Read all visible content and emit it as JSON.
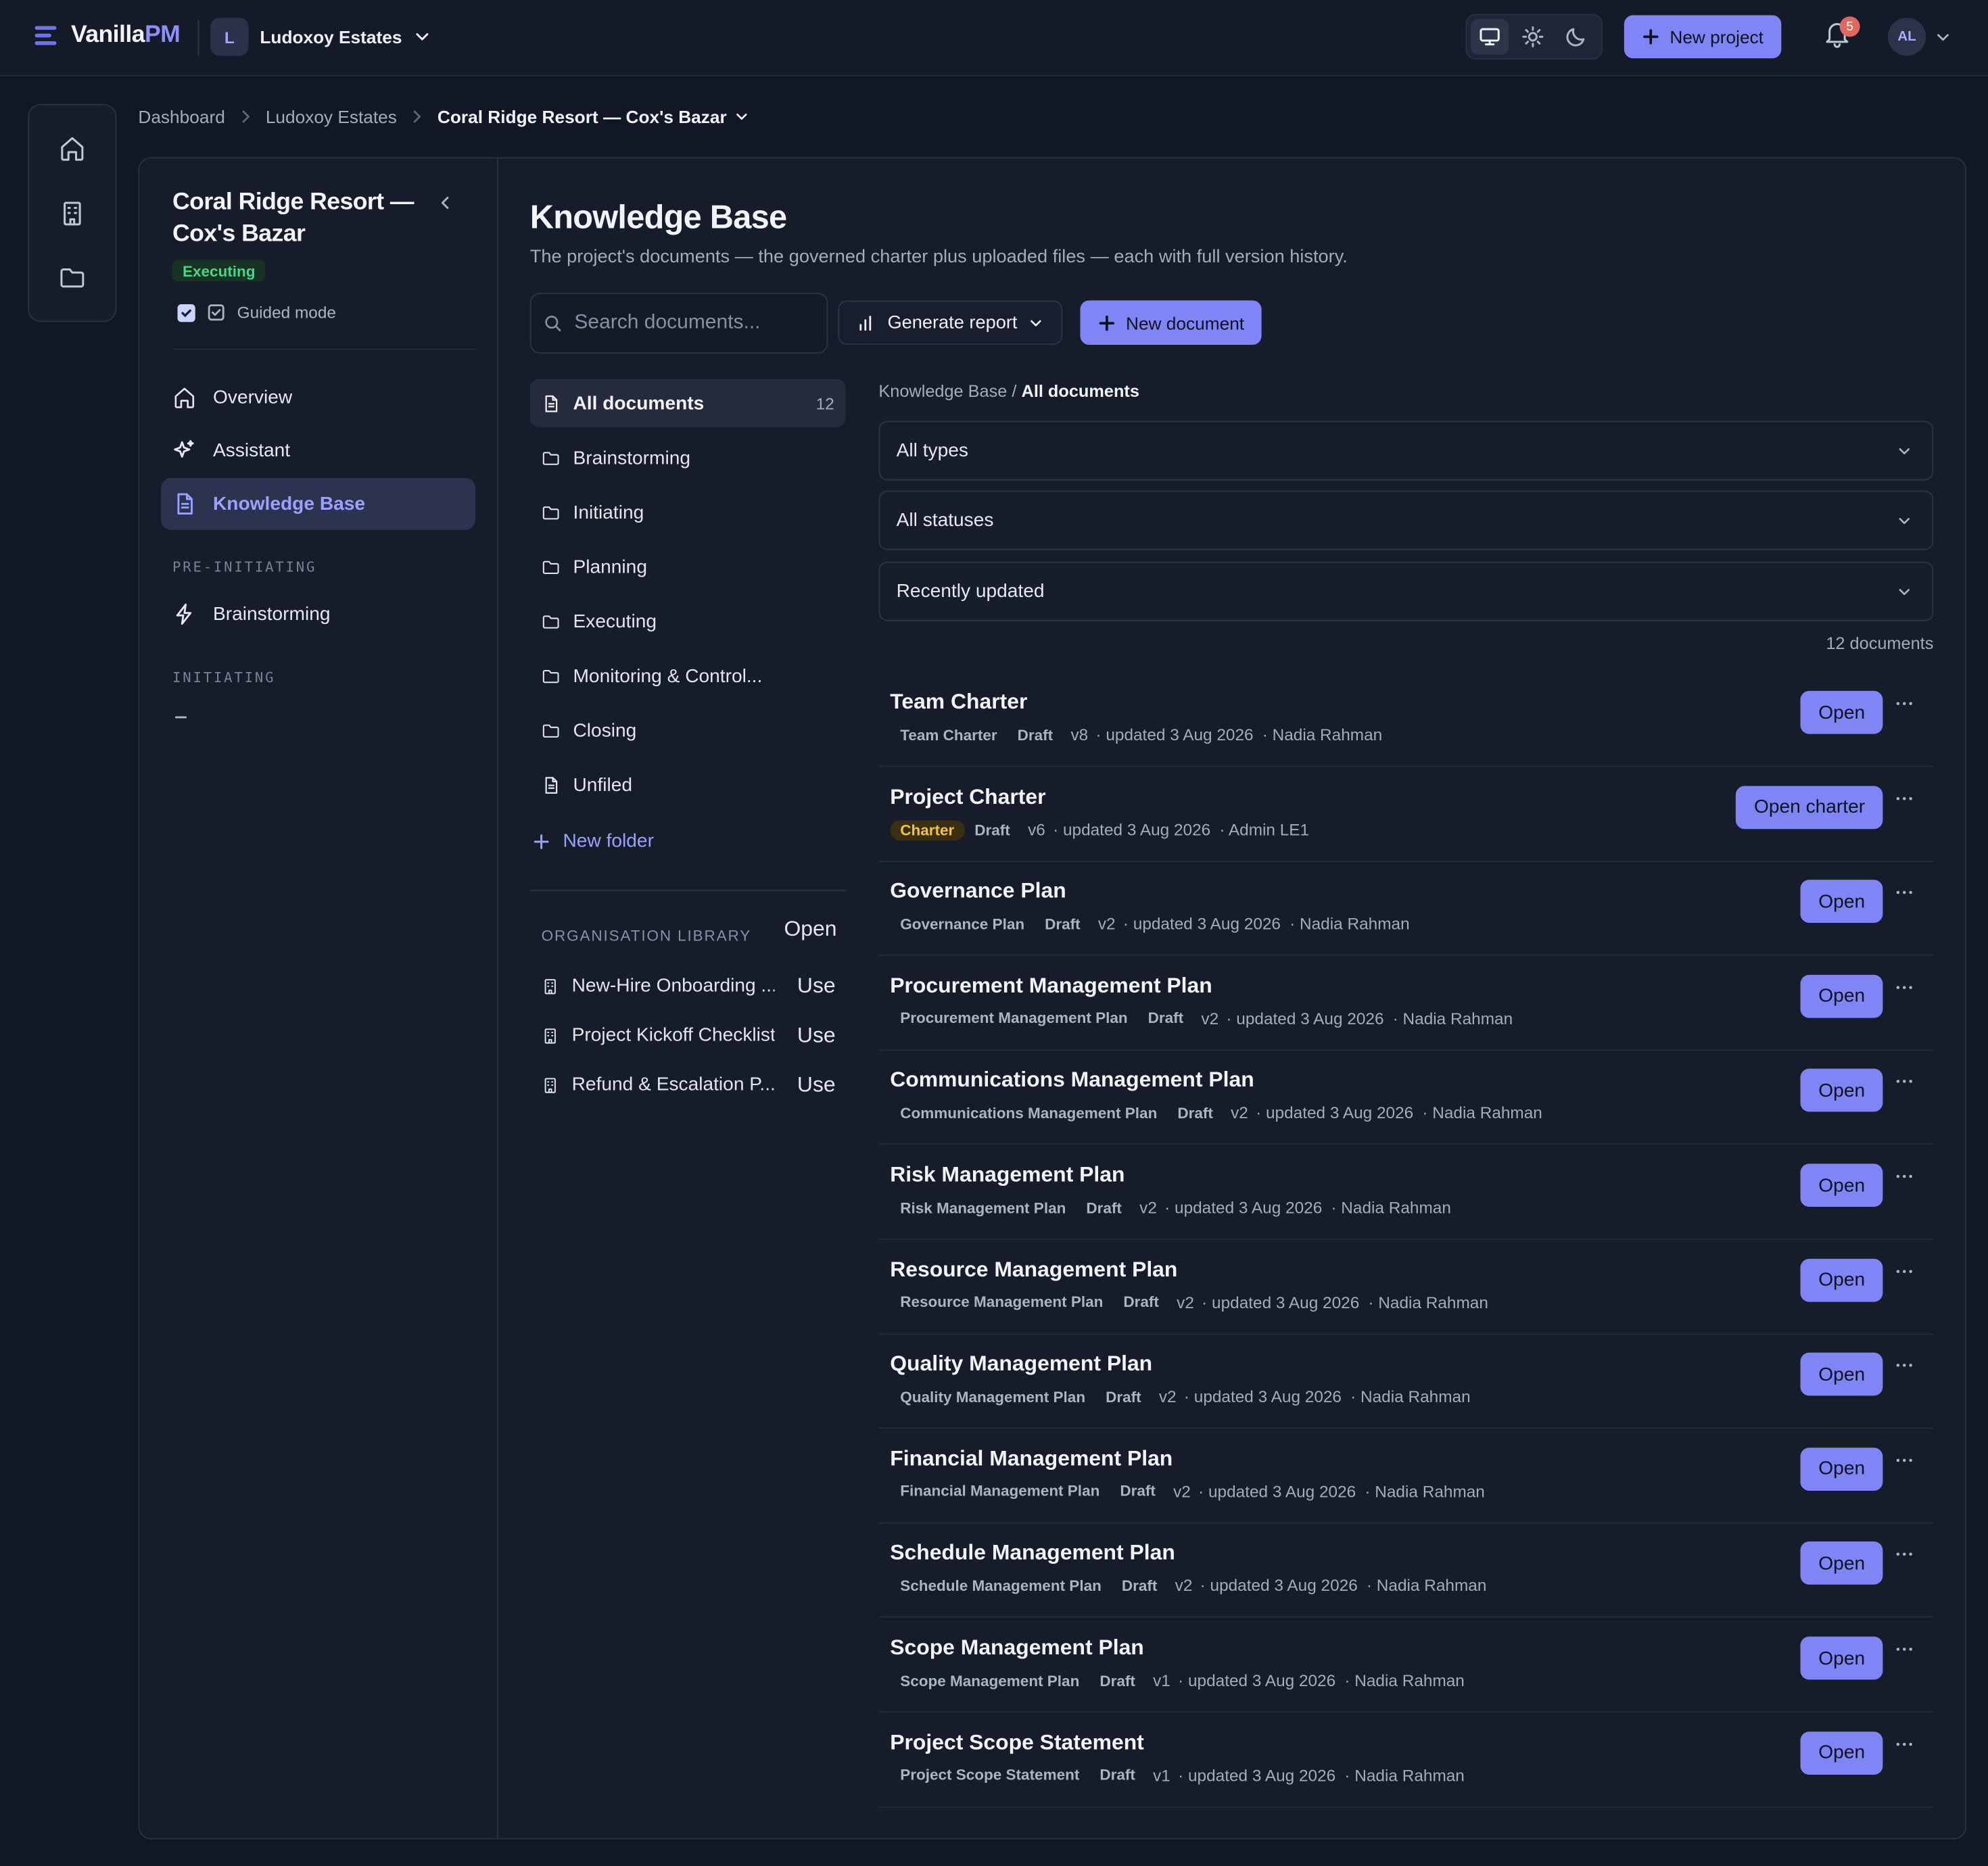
{
  "app": {
    "brand_main": "Vanilla",
    "brand_accent": "PM",
    "workspace_initial": "L",
    "workspace_name": "Ludoxoy Estates",
    "new_project_label": "New project",
    "notification_count": "5",
    "avatar_initials": "AL"
  },
  "breadcrumb": [
    "Dashboard",
    "Ludoxoy Estates",
    "Coral Ridge Resort — Cox's Bazar"
  ],
  "project": {
    "title": "Coral Ridge Resort — Cox's Bazar",
    "status": "Executing",
    "guided_mode_label": "Guided mode"
  },
  "nav": {
    "items": [
      "Overview",
      "Assistant",
      "Knowledge Base"
    ],
    "section_pre": "PRE-INITIATING",
    "pre_items": [
      "Brainstorming"
    ],
    "section_init": "INITIATING"
  },
  "page": {
    "title": "Knowledge Base",
    "subtitle": "The project's documents — the governed charter plus uploaded files — each with full version history.",
    "search_placeholder": "Search documents...",
    "generate_label": "Generate report",
    "new_doc_label": "New document"
  },
  "folders": {
    "all_label": "All documents",
    "all_count": "12",
    "items": [
      "Brainstorming",
      "Initiating",
      "Planning",
      "Executing",
      "Monitoring & Control...",
      "Closing",
      "Unfiled"
    ],
    "new_folder_label": "New folder"
  },
  "library": {
    "label": "ORGANISATION LIBRARY",
    "open_label": "Open",
    "use_label": "Use",
    "items": [
      "New-Hire Onboarding ...",
      "Project Kickoff Checklist",
      "Refund & Escalation P..."
    ]
  },
  "list": {
    "crumb_root": "Knowledge Base",
    "crumb_sep": "/",
    "crumb_current": "All documents",
    "filters": [
      "All types",
      "All statuses",
      "Recently updated"
    ],
    "count_label": "12 documents",
    "docs": [
      {
        "title": "Team Charter",
        "type": "Team Charter",
        "status": "Draft",
        "version": "v8",
        "updated": "· updated 3 Aug 2026",
        "author": "· Nadia Rahman",
        "action": "Open"
      },
      {
        "title": "Project Charter",
        "type": "Charter",
        "status": "Draft",
        "version": "v6",
        "updated": "· updated 3 Aug 2026",
        "author": "· Admin LE1",
        "action": "Open charter"
      },
      {
        "title": "Governance Plan",
        "type": "Governance Plan",
        "status": "Draft",
        "version": "v2",
        "updated": "· updated 3 Aug 2026",
        "author": "· Nadia Rahman",
        "action": "Open"
      },
      {
        "title": "Procurement Management Plan",
        "type": "Procurement Management Plan",
        "status": "Draft",
        "version": "v2",
        "updated": "· updated 3 Aug 2026",
        "author": "· Nadia Rahman",
        "action": "Open"
      },
      {
        "title": "Communications Management Plan",
        "type": "Communications Management Plan",
        "status": "Draft",
        "version": "v2",
        "updated": "· updated 3 Aug 2026",
        "author": "· Nadia Rahman",
        "action": "Open"
      },
      {
        "title": "Risk Management Plan",
        "type": "Risk Management Plan",
        "status": "Draft",
        "version": "v2",
        "updated": "· updated 3 Aug 2026",
        "author": "· Nadia Rahman",
        "action": "Open"
      },
      {
        "title": "Resource Management Plan",
        "type": "Resource Management Plan",
        "status": "Draft",
        "version": "v2",
        "updated": "· updated 3 Aug 2026",
        "author": "· Nadia Rahman",
        "action": "Open"
      },
      {
        "title": "Quality Management Plan",
        "type": "Quality Management Plan",
        "status": "Draft",
        "version": "v2",
        "updated": "· updated 3 Aug 2026",
        "author": "· Nadia Rahman",
        "action": "Open"
      },
      {
        "title": "Financial Management Plan",
        "type": "Financial Management Plan",
        "status": "Draft",
        "version": "v2",
        "updated": "· updated 3 Aug 2026",
        "author": "· Nadia Rahman",
        "action": "Open"
      },
      {
        "title": "Schedule Management Plan",
        "type": "Schedule Management Plan",
        "status": "Draft",
        "version": "v2",
        "updated": "· updated 3 Aug 2026",
        "author": "· Nadia Rahman",
        "action": "Open"
      },
      {
        "title": "Scope Management Plan",
        "type": "Scope Management Plan",
        "status": "Draft",
        "version": "v1",
        "updated": "· updated 3 Aug 2026",
        "author": "· Nadia Rahman",
        "action": "Open"
      },
      {
        "title": "Project Scope Statement",
        "type": "Project Scope Statement",
        "status": "Draft",
        "version": "v1",
        "updated": "· updated 3 Aug 2026",
        "author": "· Nadia Rahman",
        "action": "Open"
      }
    ]
  },
  "colors": {
    "background": "#121726",
    "accent": "#7f85f5",
    "status_green": "#4ad488",
    "charter_amber": "#f1c14b"
  }
}
